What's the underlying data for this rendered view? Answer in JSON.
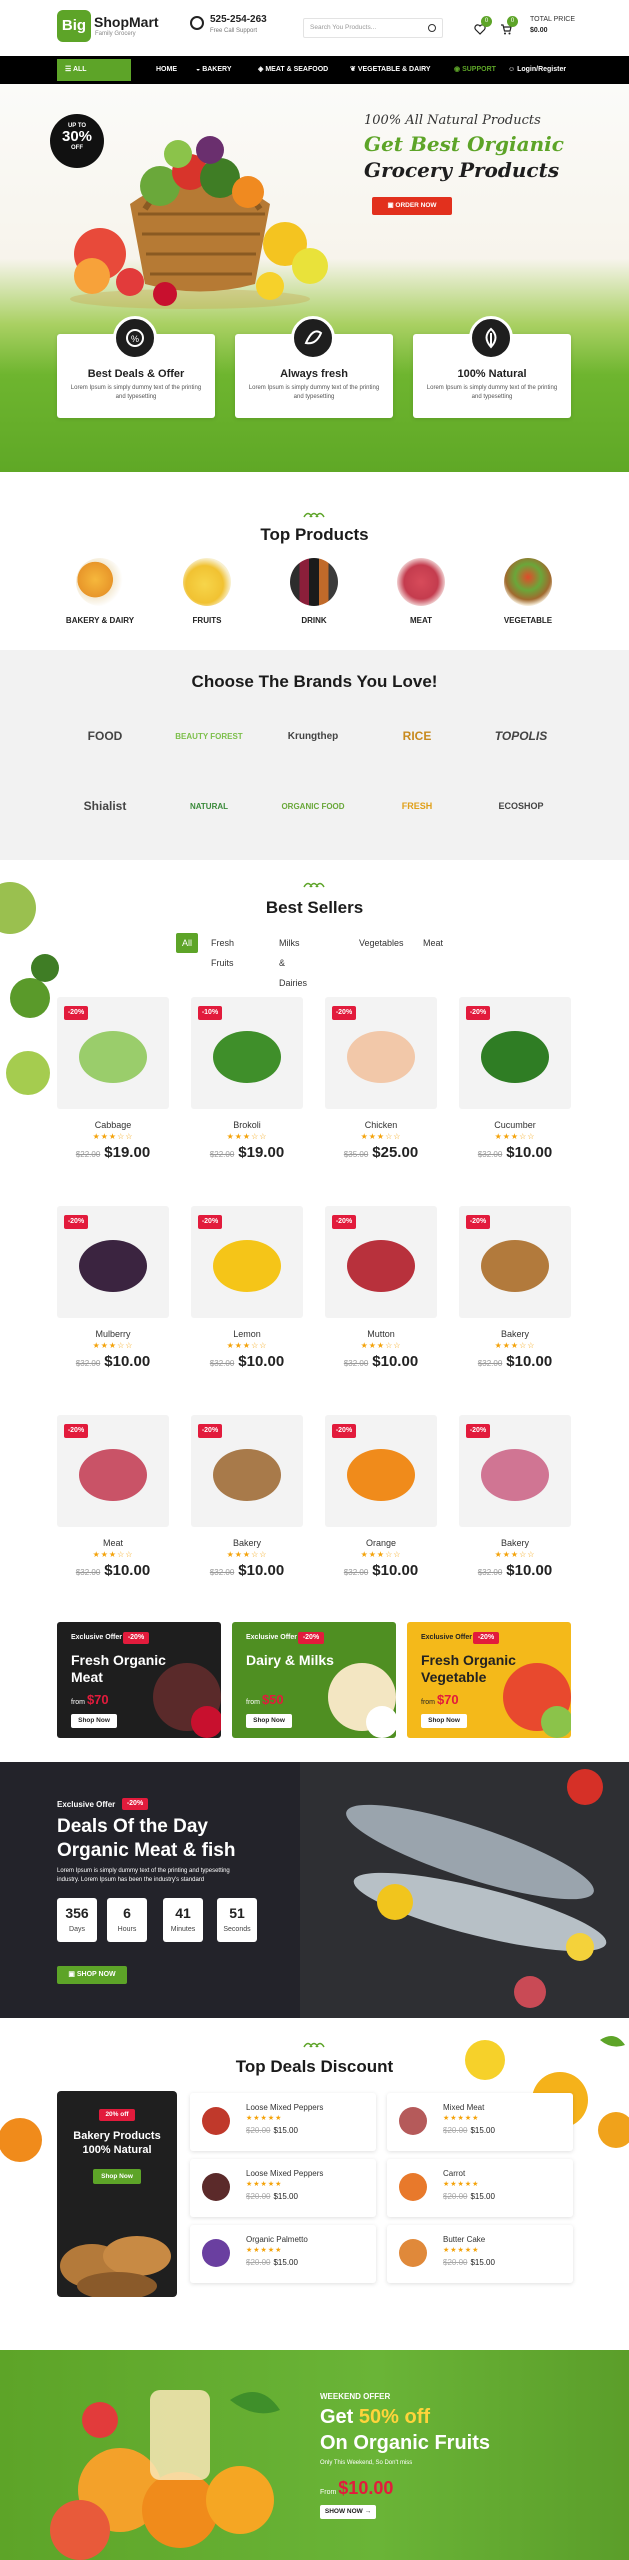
{
  "header": {
    "logo_big": "Big",
    "logo_name": "ShopMart",
    "logo_tagline": "Family Grocery",
    "phone": "525-254-263",
    "phone_sub": "Free Call Support",
    "search_placeholder": "Search You Products...",
    "wishlist_count": "0",
    "cart_count": "0",
    "total_label": "TOTAL PRICE",
    "total_value": "$0.00"
  },
  "nav": {
    "categories": "ALL CATEGORIES",
    "items": [
      "HOME",
      "BAKERY",
      "MEAT & SEAFOOD",
      "VEGETABLE & DAIRY",
      "SUPPORT",
      "Login/Register"
    ]
  },
  "hero": {
    "badge_up": "UP TO",
    "badge_pct": "30%",
    "badge_off": "OFF",
    "line1": "100% All Natural Products",
    "line2": "Get Best Orgianic",
    "line3": "Grocery Products",
    "button": "ORDER NOW",
    "features": [
      {
        "title": "Best Deals & Offer",
        "text": "Lorem Ipsum is simply dummy text of the printing and typesetting",
        "icon": "offer-icon"
      },
      {
        "title": "Always fresh",
        "text": "Lorem Ipsum is simply dummy text of the printing and typesetting",
        "icon": "fresh-icon"
      },
      {
        "title": "100% Natural",
        "text": "Lorem Ipsum is simply dummy text of the printing and typesetting",
        "icon": "natural-icon"
      }
    ]
  },
  "top_products": {
    "title": "Top Products",
    "items": [
      "BAKERY & DAIRY",
      "FRUITS",
      "DRINK",
      "MEAT",
      "VEGETABLE"
    ]
  },
  "brands": {
    "title": "Choose The Brands You Love!",
    "items": [
      "FOOD",
      "BEAUTY FOREST",
      "Krungthep",
      "RICE",
      "TOPOLIS",
      "Shialist",
      "NATURAL",
      "ORGANIC FOOD",
      "FRESH",
      "ECOSHOP"
    ]
  },
  "best_sellers": {
    "title": "Best Sellers",
    "tabs": [
      "All",
      "Fresh Fruits",
      "Milks & Dairies",
      "Vegetables",
      "Meat"
    ],
    "products": [
      {
        "name": "Cabbage",
        "discount": "-20%",
        "old": "$22.00",
        "price": "$19.00",
        "color": "#9acd6b"
      },
      {
        "name": "Brokoli",
        "discount": "-10%",
        "old": "$22.00",
        "price": "$19.00",
        "color": "#3f8f2a"
      },
      {
        "name": "Chicken",
        "discount": "-20%",
        "old": "$35.00",
        "price": "$25.00",
        "color": "#f2c8a9"
      },
      {
        "name": "Cucumber",
        "discount": "-20%",
        "old": "$32.00",
        "price": "$10.00",
        "color": "#2f7d24"
      },
      {
        "name": "Mulberry",
        "discount": "-20%",
        "old": "$32.00",
        "price": "$10.00",
        "color": "#3b2440"
      },
      {
        "name": "Lemon",
        "discount": "-20%",
        "old": "$32.00",
        "price": "$10.00",
        "color": "#f5c518"
      },
      {
        "name": "Mutton",
        "discount": "-20%",
        "old": "$32.00",
        "price": "$10.00",
        "color": "#b8313c"
      },
      {
        "name": "Bakery",
        "discount": "-20%",
        "old": "$32.00",
        "price": "$10.00",
        "color": "#b27a3c"
      },
      {
        "name": "Meat",
        "discount": "-20%",
        "old": "$32.00",
        "price": "$10.00",
        "color": "#c95367"
      },
      {
        "name": "Bakery",
        "discount": "-20%",
        "old": "$32.00",
        "price": "$10.00",
        "color": "#a87a4a"
      },
      {
        "name": "Orange",
        "discount": "-20%",
        "old": "$32.00",
        "price": "$10.00",
        "color": "#f08b1b"
      },
      {
        "name": "Bakery",
        "discount": "-20%",
        "old": "$32.00",
        "price": "$10.00",
        "color": "#d07593"
      }
    ],
    "stars": "★★★☆☆"
  },
  "promo_banners": [
    {
      "label": "Exclusive Offer",
      "discount": "-20%",
      "title": "Fresh Organic Meat",
      "from": "from",
      "price": "$70",
      "button": "Shop Now",
      "bg": "#1e1e1e"
    },
    {
      "label": "Exclusive Offer",
      "discount": "-20%",
      "title": "Dairy & Milks",
      "from": "from",
      "price": "$50",
      "button": "Shop Now",
      "bg": "#4f8f22"
    },
    {
      "label": "Exclusive Offer",
      "discount": "-20%",
      "title": "Fresh Organic Vegetable",
      "from": "from",
      "price": "$70",
      "button": "Shop Now",
      "bg": "#f4b91a"
    }
  ],
  "deals": {
    "label": "Exclusive Offer",
    "discount": "-20%",
    "title1": "Deals Of the Day",
    "title2": "Organic Meat & fish",
    "text": "Lorem Ipsum is simply dummy text of the printing and typesetting industry. Lorem Ipsum has been the industry's standard",
    "timer": [
      {
        "n": "356",
        "l": "Days"
      },
      {
        "n": "6",
        "l": "Hours"
      },
      {
        "n": "41",
        "l": "Minutes"
      },
      {
        "n": "51",
        "l": "Seconds"
      }
    ],
    "button": "SHOP NOW"
  },
  "top_deals": {
    "title": "Top Deals Discount",
    "side_badge": "20% off",
    "side_title": "Bakery Products 100% Natural",
    "side_button": "Shop Now",
    "items": [
      {
        "name": "Loose Mixed Peppers",
        "old": "$20.00",
        "price": "$15.00",
        "color": "#c0392b"
      },
      {
        "name": "Mixed Meat",
        "old": "$20.00",
        "price": "$15.00",
        "color": "#b55a5a"
      },
      {
        "name": "Loose Mixed Peppers",
        "old": "$20.00",
        "price": "$15.00",
        "color": "#5b2a2a"
      },
      {
        "name": "Carrot",
        "old": "$20.00",
        "price": "$15.00",
        "color": "#e8792b"
      },
      {
        "name": "Organic Palmetto",
        "old": "$20.00",
        "price": "$15.00",
        "color": "#6a3fa0"
      },
      {
        "name": "Butter Cake",
        "old": "$20.00",
        "price": "$15.00",
        "color": "#e0893a"
      }
    ],
    "stars": "★★★★★"
  },
  "weekend": {
    "label": "WEEKEND OFFER",
    "title_pre": "Get ",
    "title_pct": "50% off",
    "title2": "On Organic Fruits",
    "sub": "Only This Weekend, So Don't miss",
    "from": "From",
    "price": "$10.00",
    "button": "SHOW NOW →"
  }
}
